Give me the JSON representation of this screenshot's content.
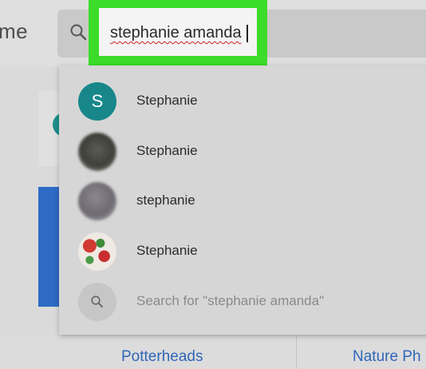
{
  "app": {
    "brand_partial": "me"
  },
  "search": {
    "query": "stephanie amanda"
  },
  "suggestions": [
    {
      "name": "Stephanie",
      "avatar_letter": "S",
      "avatar_type": "letter"
    },
    {
      "name": "Stephanie",
      "avatar_type": "photo"
    },
    {
      "name": "stephanie",
      "avatar_type": "photo"
    },
    {
      "name": "Stephanie",
      "avatar_type": "photo"
    }
  ],
  "search_for": {
    "label": "Search for \"stephanie amanda\""
  },
  "bottom_links": [
    {
      "label": "Potterheads"
    },
    {
      "label": "Nature Ph"
    }
  ],
  "colors": {
    "highlight": "#3bdc2a",
    "avatar_teal": "#17878a",
    "link_blue": "#2f66b8"
  }
}
